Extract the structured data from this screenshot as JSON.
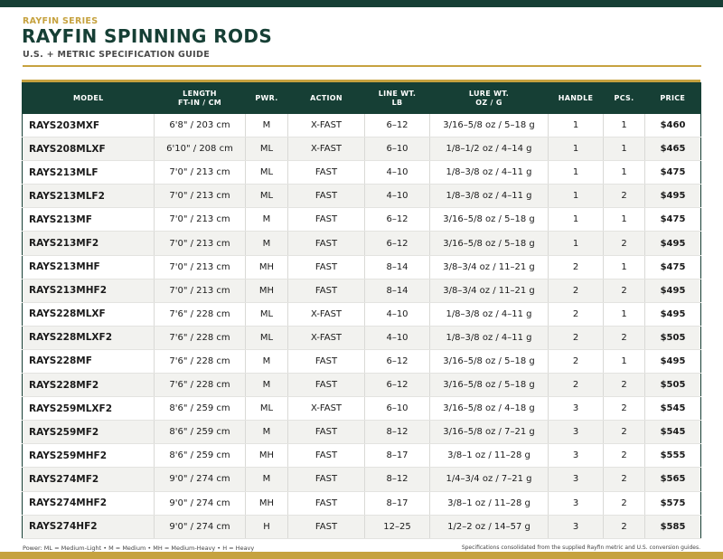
{
  "header": {
    "series": "RAYFIN SERIES",
    "title": "RAYFIN SPINNING RODS",
    "subtitle": "U.S. + METRIC SPECIFICATION GUIDE"
  },
  "table": {
    "columns": [
      {
        "line1": "MODEL",
        "line2": ""
      },
      {
        "line1": "LENGTH",
        "line2": "FT-IN / CM"
      },
      {
        "line1": "PWR.",
        "line2": ""
      },
      {
        "line1": "ACTION",
        "line2": ""
      },
      {
        "line1": "LINE WT.",
        "line2": "LB"
      },
      {
        "line1": "LURE WT.",
        "line2": "OZ / G"
      },
      {
        "line1": "HANDLE",
        "line2": ""
      },
      {
        "line1": "PCS.",
        "line2": ""
      },
      {
        "line1": "PRICE",
        "line2": ""
      }
    ],
    "rows": [
      [
        "RAYS203MXF",
        "6'8\"  /  203 cm",
        "M",
        "X-FAST",
        "6–12",
        "3/16–5/8 oz  /  5–18 g",
        "1",
        "1",
        "$460"
      ],
      [
        "RAYS208MLXF",
        "6'10\"  /  208 cm",
        "ML",
        "X-FAST",
        "6–10",
        "1/8–1/2 oz  /  4–14 g",
        "1",
        "1",
        "$465"
      ],
      [
        "RAYS213MLF",
        "7'0\"  /  213 cm",
        "ML",
        "FAST",
        "4–10",
        "1/8–3/8 oz  /  4–11 g",
        "1",
        "1",
        "$475"
      ],
      [
        "RAYS213MLF2",
        "7'0\"  /  213 cm",
        "ML",
        "FAST",
        "4–10",
        "1/8–3/8 oz  /  4–11 g",
        "1",
        "2",
        "$495"
      ],
      [
        "RAYS213MF",
        "7'0\"  /  213 cm",
        "M",
        "FAST",
        "6–12",
        "3/16–5/8 oz  /  5–18 g",
        "1",
        "1",
        "$475"
      ],
      [
        "RAYS213MF2",
        "7'0\"  /  213 cm",
        "M",
        "FAST",
        "6–12",
        "3/16–5/8 oz  /  5–18 g",
        "1",
        "2",
        "$495"
      ],
      [
        "RAYS213MHF",
        "7'0\"  /  213 cm",
        "MH",
        "FAST",
        "8–14",
        "3/8–3/4 oz  /  11–21 g",
        "2",
        "1",
        "$475"
      ],
      [
        "RAYS213MHF2",
        "7'0\"  /  213 cm",
        "MH",
        "FAST",
        "8–14",
        "3/8–3/4 oz  /  11–21 g",
        "2",
        "2",
        "$495"
      ],
      [
        "RAYS228MLXF",
        "7'6\"  /  228 cm",
        "ML",
        "X-FAST",
        "4–10",
        "1/8–3/8 oz  /  4–11 g",
        "2",
        "1",
        "$495"
      ],
      [
        "RAYS228MLXF2",
        "7'6\"  /  228 cm",
        "ML",
        "X-FAST",
        "4–10",
        "1/8–3/8 oz  /  4–11 g",
        "2",
        "2",
        "$505"
      ],
      [
        "RAYS228MF",
        "7'6\"  /  228 cm",
        "M",
        "FAST",
        "6–12",
        "3/16–5/8 oz  /  5–18 g",
        "2",
        "1",
        "$495"
      ],
      [
        "RAYS228MF2",
        "7'6\"  /  228 cm",
        "M",
        "FAST",
        "6–12",
        "3/16–5/8 oz  /  5–18 g",
        "2",
        "2",
        "$505"
      ],
      [
        "RAYS259MLXF2",
        "8'6\"  /  259 cm",
        "ML",
        "X-FAST",
        "6–10",
        "3/16–5/8 oz  /  4–18 g",
        "3",
        "2",
        "$545"
      ],
      [
        "RAYS259MF2",
        "8'6\"  /  259 cm",
        "M",
        "FAST",
        "8–12",
        "3/16–5/8 oz  /  7–21 g",
        "3",
        "2",
        "$545"
      ],
      [
        "RAYS259MHF2",
        "8'6\"  /  259 cm",
        "MH",
        "FAST",
        "8–17",
        "3/8–1 oz  /  11–28 g",
        "3",
        "2",
        "$555"
      ],
      [
        "RAYS274MF2",
        "9'0\"  /  274 cm",
        "M",
        "FAST",
        "8–12",
        "1/4–3/4 oz  /  7–21 g",
        "3",
        "2",
        "$565"
      ],
      [
        "RAYS274MHF2",
        "9'0\"  /  274 cm",
        "MH",
        "FAST",
        "8–17",
        "3/8–1 oz  /  11–28 g",
        "3",
        "2",
        "$575"
      ],
      [
        "RAYS274HF2",
        "9'0\"  /  274 cm",
        "H",
        "FAST",
        "12–25",
        "1/2–2 oz  /  14–57 g",
        "3",
        "2",
        "$585"
      ]
    ]
  },
  "footer": {
    "legend": "Power: ML = Medium-Light  •  M = Medium  •  MH = Medium-Heavy  •  H = Heavy",
    "note": "Specifications consolidated from the supplied Rayfin metric and U.S. conversion guides."
  },
  "colors": {
    "brand_green": "#163f35",
    "accent_gold": "#c6a23f"
  }
}
